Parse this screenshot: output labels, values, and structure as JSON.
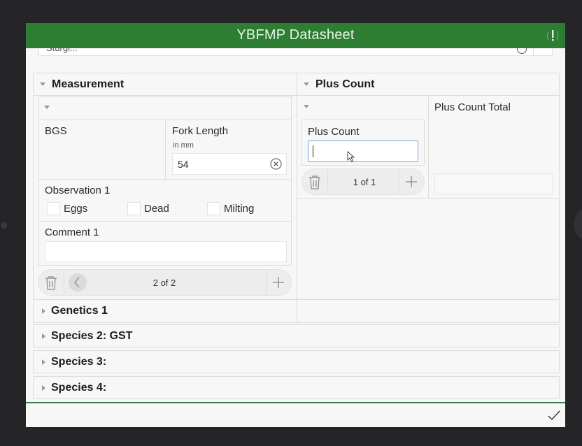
{
  "window": {
    "title": "YBFMP Datasheet",
    "title_icon": "alert-exclamation-icon",
    "accent_color": "#2d7d32"
  },
  "top_field": {
    "partial_value": "Sturgi..."
  },
  "measurement": {
    "title": "Measurement",
    "fields": {
      "bgs_label": "BGS",
      "fork_length_label": "Fork Length",
      "fork_length_hint": "in mm",
      "fork_length_value": "54",
      "observation_label": "Observation 1",
      "checkboxes": [
        {
          "label": "Eggs",
          "checked": false
        },
        {
          "label": "Dead",
          "checked": false
        },
        {
          "label": "Milting",
          "checked": false
        }
      ],
      "comment_label": "Comment 1",
      "comment_value": ""
    },
    "pager": {
      "count": "2 of 2",
      "icons": [
        "trash-icon",
        "chevron-left-icon",
        "plus-icon"
      ]
    }
  },
  "plus_count": {
    "title": "Plus Count",
    "field_label": "Plus Count",
    "field_value": "",
    "total_label": "Plus Count Total",
    "total_value": "",
    "pager": {
      "count": "1 of 1",
      "icons": [
        "trash-icon",
        "plus-icon"
      ]
    }
  },
  "collapsed_sections": [
    {
      "label": "Genetics 1"
    },
    {
      "label": "Species 2: GST"
    },
    {
      "label": "Species 3:"
    },
    {
      "label": "Species 4:"
    }
  ],
  "footer": {
    "submit_icon": "checkmark-icon"
  }
}
